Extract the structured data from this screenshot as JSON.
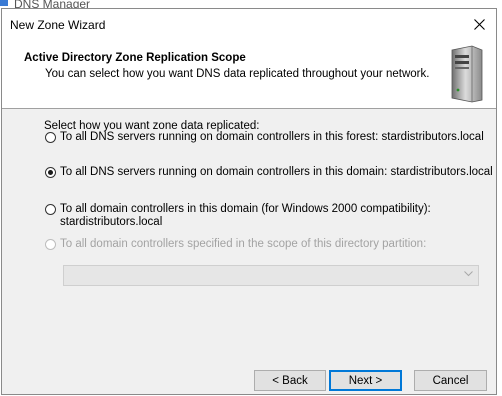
{
  "background_app": {
    "title": "DNS Manager"
  },
  "dialog": {
    "title": "New Zone Wizard",
    "close_label": "✕"
  },
  "header": {
    "title": "Active Directory Zone Replication Scope",
    "subtitle": "You can select how you want DNS data replicated throughout your network."
  },
  "content": {
    "prompt": "Select how you want zone data replicated:",
    "options": [
      {
        "label": "To all DNS servers running on domain controllers in this forest: stardistributors.local",
        "checked": false,
        "enabled": true
      },
      {
        "label": "To all DNS servers running on domain controllers in this domain: stardistributors.local",
        "checked": true,
        "enabled": true
      },
      {
        "label_line1": "To all domain controllers in this domain (for Windows 2000 compatibility):",
        "label_line2": "stardistributors.local",
        "checked": false,
        "enabled": true
      },
      {
        "label": "To all domain controllers specified in the scope of this directory partition:",
        "checked": false,
        "enabled": false
      }
    ],
    "partition_select": {
      "value": "",
      "enabled": false
    }
  },
  "footer": {
    "back_label": "< Back",
    "next_label": "Next >",
    "cancel_label": "Cancel"
  },
  "icons": {
    "header_icon": "server-icon",
    "close": "close-icon",
    "dropdown": "chevron-down-icon"
  },
  "colors": {
    "dialog_bg": "#f0f0f0",
    "header_bg": "#ffffff",
    "default_button_border": "#0078d7",
    "disabled_text": "#a3a3a3"
  }
}
